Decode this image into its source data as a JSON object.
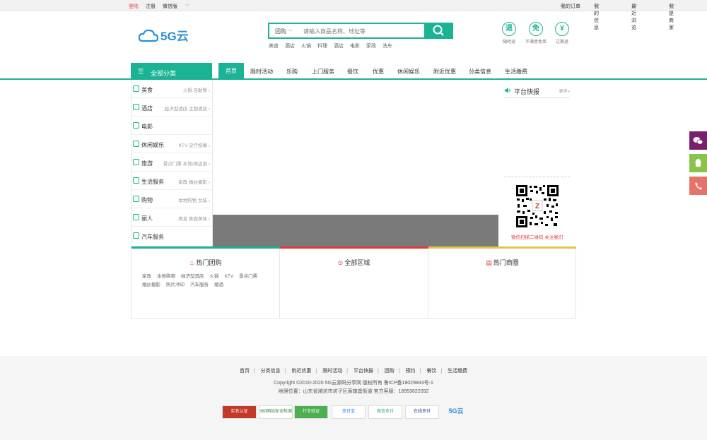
{
  "topbar": {
    "login": "登陆",
    "register": "注册",
    "wechat": "微信版",
    "my_orders": "我的订单",
    "my_info": "我的信息",
    "recent": "最近浏览",
    "merchant": "我是商家"
  },
  "search": {
    "type": "团购",
    "placeholder": "请输入商品名称、地址等",
    "hot": [
      "美食",
      "酒店",
      "火锅",
      "料理",
      "酒店",
      "电影",
      "家政",
      "洗车"
    ]
  },
  "guarantees": [
    {
      "icon": "退",
      "label": "随时退"
    },
    {
      "icon": "免",
      "label": "不满意免单"
    },
    {
      "icon": "¥",
      "label": "过期退"
    }
  ],
  "nav": {
    "all_categories": "全部分类",
    "items": [
      "首页",
      "限时活动",
      "乐购",
      "上门服务",
      "餐饮",
      "优惠",
      "休闲娱乐",
      "附近优惠",
      "分类信息",
      "生活缴费"
    ]
  },
  "categories": [
    {
      "name": "美食",
      "sub": "火锅   自助餐 ›"
    },
    {
      "name": "酒店",
      "sub": "经济型酒店   主题酒店 ›"
    },
    {
      "name": "电影",
      "sub": ""
    },
    {
      "name": "休闲娱乐",
      "sub": "KTV   足疗按摩 ›"
    },
    {
      "name": "旅游",
      "sub": "景点门票   本地/周边游 ›"
    },
    {
      "name": "生活服务",
      "sub": "家政   婚纱摄影 ›"
    },
    {
      "name": "购物",
      "sub": "本地购物   女装 ›"
    },
    {
      "name": "丽人",
      "sub": "美发   美容美体 ›"
    },
    {
      "name": "汽车服务",
      "sub": ""
    }
  ],
  "platform": {
    "title": "平台快报",
    "more": "更多»",
    "qr_caption": "微信扫描二维码 关注我们"
  },
  "boxes": {
    "hot_groupbuy": "热门团购",
    "all_region": "全部区域",
    "hot_shops": "热门商圈",
    "tags": [
      "家政",
      "本地购物",
      "经济型酒店",
      "火锅",
      "KTV",
      "景点门票",
      "婚纱摄影",
      "照片冲印",
      "汽车服务",
      "婚酒"
    ]
  },
  "footer": {
    "links": [
      "首页",
      "分类信息",
      "附近优惠",
      "限时活动",
      "平台快报",
      "团购",
      "预约",
      "餐饮",
      "生活缴费"
    ],
    "copyright": "Copyright ©2010-2020 5G云源码分享网 版权所有 鲁ICP备18029843号-1",
    "address": "地理位置：山东省潍坊市坊子区黄旗堡街道 官方客服：18953622092",
    "badges": [
      "实名认证",
      "360网站安全检测",
      "行业验证",
      "支付宝",
      "微信支付",
      "在线支付",
      "5G云"
    ]
  },
  "colors": {
    "accent": "#1ab394",
    "red": "#e4393c",
    "yellow": "#e8c14a",
    "wechat": "#7a1f6e",
    "qq": "#8bc34a",
    "phone": "#e57368"
  }
}
